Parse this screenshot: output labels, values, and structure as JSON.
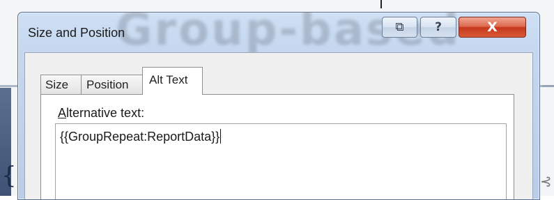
{
  "dialog": {
    "title": "Size and Position",
    "background_title": "Group-based",
    "buttons": {
      "restore": "⧉",
      "help": "?",
      "close": "X"
    }
  },
  "tabs": [
    {
      "label": "Size",
      "selected": false
    },
    {
      "label": "Position",
      "selected": false
    },
    {
      "label": "Alt Text",
      "selected": true
    }
  ],
  "alt_text": {
    "label_first": "A",
    "label_rest": "lternative text:",
    "value": "{{GroupRepeat:ReportData}}"
  },
  "background": {
    "brace": "{",
    "right_glyph": "⊰"
  },
  "colors": {
    "close_button": "#c6381b",
    "titlebar": "#c4d7ef",
    "panel": "#f0f0f0"
  }
}
